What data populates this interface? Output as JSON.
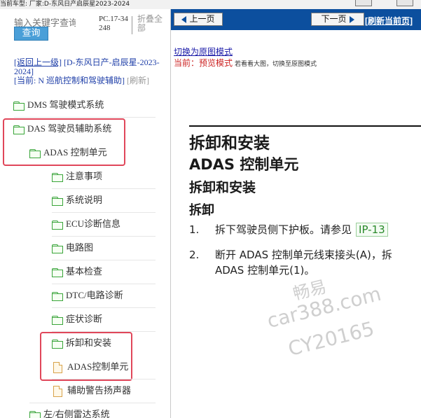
{
  "top_strip": {
    "text": "当前车型:  厂家:D-东风日产启辰星2023-2024"
  },
  "left": {
    "search_placeholder": "输入关键字查询",
    "query_button": "查询",
    "code": "PC.17-34248",
    "collapse_all": "折叠全部",
    "nav": {
      "back": "[返回上一级]",
      "path": "[D-东风日产-启辰星-2023-2024]",
      "current": "[当前: N 巡航控制和驾驶辅助]",
      "refresh": "[刷新]"
    },
    "tree": [
      {
        "label": "DMS 驾驶模式系统",
        "icon": "folder-icon"
      },
      {
        "label": "DAS 驾驶员辅助系统",
        "icon": "folder-icon"
      },
      {
        "label": "ADAS 控制单元",
        "icon": "folder-icon"
      },
      {
        "label": "注意事项",
        "icon": "folder-icon"
      },
      {
        "label": "系统说明",
        "icon": "folder-icon"
      },
      {
        "label": "ECU诊断信息",
        "icon": "folder-icon"
      },
      {
        "label": "电路图",
        "icon": "folder-icon"
      },
      {
        "label": "基本检查",
        "icon": "folder-icon"
      },
      {
        "label": "DTC/电路诊断",
        "icon": "folder-icon"
      },
      {
        "label": "症状诊断",
        "icon": "folder-icon"
      },
      {
        "label": "拆卸和安装",
        "icon": "folder-icon"
      },
      {
        "label": "ADAS控制单元",
        "icon": "document-icon"
      },
      {
        "label": "辅助警告扬声器",
        "icon": "document-icon"
      },
      {
        "label": "左/右侧雷达系统",
        "icon": "folder-icon"
      }
    ]
  },
  "right": {
    "prev_button": "上一页",
    "next_button": "下一页",
    "refresh_page": "[刷新当前页]",
    "switch_link": "切换为原图模式",
    "current_label": "当前：预览模式",
    "current_hint": "若看看大图，切换至原图模式",
    "doc": {
      "heading1": "拆卸和安装",
      "heading2": "ADAS 控制单元",
      "heading3": "拆卸和安装",
      "heading4": "拆卸",
      "steps": [
        {
          "num": "1.",
          "text": "拆下驾驶员侧下护板。请参见",
          "ref": "IP-13"
        },
        {
          "num": "2.",
          "text": "断开 ADAS 控制单元线束接头(A)，拆",
          "text2": "ADAS 控制单元(1)。"
        }
      ]
    },
    "watermark": [
      "畅易",
      "car388.com",
      "CY20165"
    ]
  },
  "colors": {
    "toolbar": "#0c4f9e",
    "highlight": "#e0475a",
    "folder": "#3aa53a",
    "link": "#1a1aa8"
  }
}
